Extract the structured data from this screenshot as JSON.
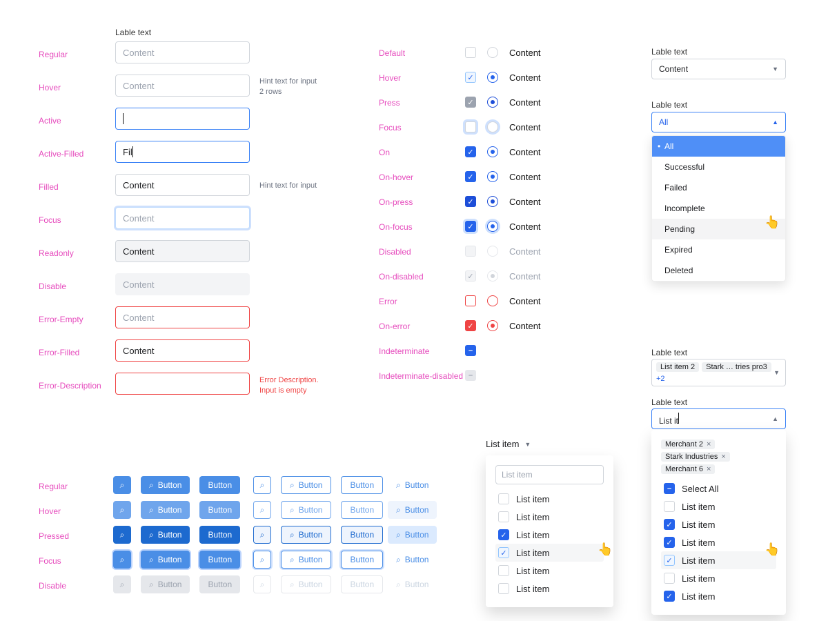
{
  "common": {
    "label_text": "Lable text",
    "content_placeholder": "Content",
    "content_value": "Content",
    "hint_2rows_l1": "Hint text for input",
    "hint_2rows_l2": "2 rows",
    "hint_1row": "Hint text for input",
    "err_desc_l1": "Error Description.",
    "err_desc_l2": "Input is empty"
  },
  "input_states": {
    "regular": "Regular",
    "hover": "Hover",
    "active": "Active",
    "active_filled": "Active-Filled",
    "filled": "Filled",
    "focus": "Focus",
    "readonly": "Readonly",
    "disable": "Disable",
    "error_empty": "Error-Empty",
    "error_filled": "Error-Filled",
    "error_desc": "Error-Description",
    "active_filled_value": "Fil"
  },
  "checkradio": {
    "content": "Content",
    "states": {
      "default": "Default",
      "hover": "Hover",
      "press": "Press",
      "focus": "Focus",
      "on": "On",
      "on_hover": "On-hover",
      "on_press": "On-press",
      "on_focus": "On-focus",
      "disabled": "Disabled",
      "on_disabled": "On-disabled",
      "error": "Error",
      "on_error": "On-error",
      "indeterminate": "Indeterminate",
      "indeterminate_disabled": "Indeterminate-disabled"
    }
  },
  "btn_states": {
    "regular": "Regular",
    "hover": "Hover",
    "pressed": "Pressed",
    "focus": "Focus",
    "disable": "Disable"
  },
  "btn_label": "Button",
  "select1": {
    "value": "Content"
  },
  "select2": {
    "value": "All",
    "options": [
      "All",
      "Successful",
      "Failed",
      "Incomplete",
      "Pending",
      "Expired",
      "Deleted"
    ],
    "hover_index": 4
  },
  "multiselect_closed": {
    "chips": [
      "List item 2",
      "Stark … tries pro3"
    ],
    "more": "+2"
  },
  "multiselect_open": {
    "typed": "List it",
    "chips": [
      "Merchant 2",
      "Stark Industries",
      "Merchant 6"
    ],
    "select_all": "Select All",
    "items": [
      {
        "label": "List item",
        "checked": false,
        "hover": false
      },
      {
        "label": "List item",
        "checked": true,
        "hover": false
      },
      {
        "label": "List item",
        "checked": true,
        "hover": false
      },
      {
        "label": "List item",
        "checked": true,
        "hover": true
      },
      {
        "label": "List item",
        "checked": false,
        "hover": false
      },
      {
        "label": "List item",
        "checked": true,
        "hover": false
      }
    ]
  },
  "dropdown_simple": {
    "trigger": "List item",
    "search_placeholder": "List item",
    "items": [
      {
        "label": "List item",
        "checked": false,
        "hover": false
      },
      {
        "label": "List item",
        "checked": false,
        "hover": false
      },
      {
        "label": "List item",
        "checked": true,
        "hover": false
      },
      {
        "label": "List item",
        "checked": true,
        "hover": true
      },
      {
        "label": "List item",
        "checked": false,
        "hover": false
      },
      {
        "label": "List item",
        "checked": false,
        "hover": false
      }
    ]
  }
}
